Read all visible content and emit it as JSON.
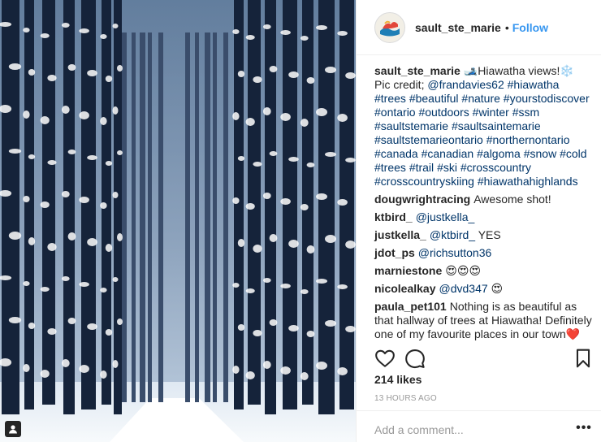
{
  "post": {
    "username": "sault_ste_marie",
    "dot": "•",
    "follow_label": "Follow",
    "comments": [
      {
        "user": "sault_ste_marie",
        "parts": [
          {
            "t": "text",
            "v": "🎿Hiawatha views!❄️ Pic credit; "
          },
          {
            "t": "mention",
            "v": "@frandavies62"
          },
          {
            "t": "text",
            "v": " "
          },
          {
            "t": "tag",
            "v": "#hiawatha"
          },
          {
            "t": "text",
            "v": " "
          },
          {
            "t": "tag",
            "v": "#trees"
          },
          {
            "t": "text",
            "v": " "
          },
          {
            "t": "tag",
            "v": "#beautiful"
          },
          {
            "t": "text",
            "v": " "
          },
          {
            "t": "tag",
            "v": "#nature"
          },
          {
            "t": "text",
            "v": " "
          },
          {
            "t": "tag",
            "v": "#yourstodiscover"
          },
          {
            "t": "text",
            "v": " "
          },
          {
            "t": "tag",
            "v": "#ontario"
          },
          {
            "t": "text",
            "v": " "
          },
          {
            "t": "tag",
            "v": "#outdoors"
          },
          {
            "t": "text",
            "v": " "
          },
          {
            "t": "tag",
            "v": "#winter"
          },
          {
            "t": "text",
            "v": " "
          },
          {
            "t": "tag",
            "v": "#ssm"
          },
          {
            "t": "text",
            "v": " "
          },
          {
            "t": "tag",
            "v": "#saultstemarie"
          },
          {
            "t": "text",
            "v": " "
          },
          {
            "t": "tag",
            "v": "#saultsaintemarie"
          },
          {
            "t": "text",
            "v": " "
          },
          {
            "t": "tag",
            "v": "#saultstemarieontario"
          },
          {
            "t": "text",
            "v": " "
          },
          {
            "t": "tag",
            "v": "#northernontario"
          },
          {
            "t": "text",
            "v": " "
          },
          {
            "t": "tag",
            "v": "#canada"
          },
          {
            "t": "text",
            "v": " "
          },
          {
            "t": "tag",
            "v": "#canadian"
          },
          {
            "t": "text",
            "v": " "
          },
          {
            "t": "tag",
            "v": "#algoma"
          },
          {
            "t": "text",
            "v": " "
          },
          {
            "t": "tag",
            "v": "#snow"
          },
          {
            "t": "text",
            "v": " "
          },
          {
            "t": "tag",
            "v": "#cold"
          },
          {
            "t": "text",
            "v": " "
          },
          {
            "t": "tag",
            "v": "#trees"
          },
          {
            "t": "text",
            "v": " "
          },
          {
            "t": "tag",
            "v": "#trail"
          },
          {
            "t": "text",
            "v": " "
          },
          {
            "t": "tag",
            "v": "#ski"
          },
          {
            "t": "text",
            "v": " "
          },
          {
            "t": "tag",
            "v": "#crosscountry"
          },
          {
            "t": "text",
            "v": " "
          },
          {
            "t": "tag",
            "v": "#crosscountryskiing"
          },
          {
            "t": "text",
            "v": " "
          },
          {
            "t": "tag",
            "v": "#hiawathahighlands"
          }
        ]
      },
      {
        "user": "dougwrightracing",
        "parts": [
          {
            "t": "text",
            "v": "Awesome shot!"
          }
        ]
      },
      {
        "user": "ktbird_",
        "parts": [
          {
            "t": "mention",
            "v": "@justkella_"
          }
        ]
      },
      {
        "user": "justkella_",
        "parts": [
          {
            "t": "mention",
            "v": "@ktbird_"
          },
          {
            "t": "text",
            "v": " YES"
          }
        ]
      },
      {
        "user": "jdot_ps",
        "parts": [
          {
            "t": "mention",
            "v": "@richsutton36"
          }
        ]
      },
      {
        "user": "marniestone",
        "parts": [
          {
            "t": "text",
            "v": "😍😍😍"
          }
        ]
      },
      {
        "user": "nicolealkay",
        "parts": [
          {
            "t": "mention",
            "v": "@dvd347"
          },
          {
            "t": "text",
            "v": " 😍"
          }
        ]
      },
      {
        "user": "paula_pet101",
        "parts": [
          {
            "t": "text",
            "v": "Nothing is as beautiful as that hallway of trees at Hiawatha! Definitely one of my favourite places in our town❤️"
          }
        ]
      }
    ],
    "likes": "214 likes",
    "timestamp": "13 HOURS AGO",
    "add_comment_placeholder": "Add a comment...",
    "more_label": "•••",
    "icons": {
      "like": "heart-icon",
      "comment": "comment-icon",
      "save": "bookmark-icon",
      "photo_user": "user-tag-icon"
    },
    "colors": {
      "link": "#3897f0",
      "tag": "#003569",
      "muted": "#999999",
      "text": "#262626"
    }
  }
}
